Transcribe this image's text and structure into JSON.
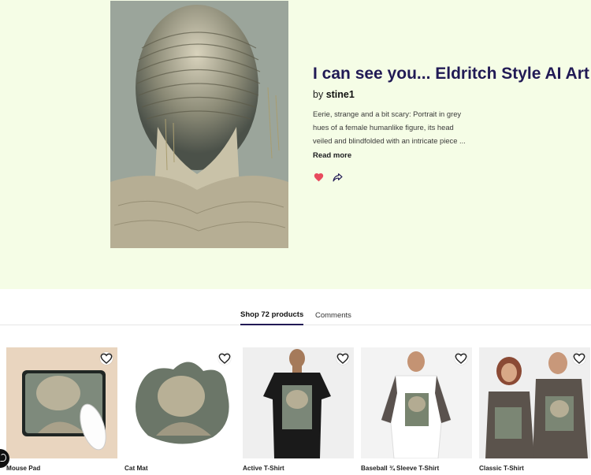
{
  "artwork": {
    "title": "I can see you... Eldritch Style AI Art",
    "by_label": "by",
    "artist": "stine1",
    "description": "Eerie, strange and a bit scary: Portrait in grey hues of a female humanlike figure, its head veiled and blindfolded with an intricate piece ...",
    "read_more": "Read more",
    "favorite_color": "#e84b5e"
  },
  "tabs": {
    "shop": "Shop 72 products",
    "comments": "Comments"
  },
  "products": [
    {
      "name": "Mouse Pad"
    },
    {
      "name": "Cat Mat"
    },
    {
      "name": "Active T-Shirt"
    },
    {
      "name": "Baseball ¾ Sleeve T-Shirt"
    },
    {
      "name": "Classic T-Shirt"
    }
  ],
  "colors": {
    "hero_bg": "#f5fde6",
    "title": "#211a55"
  },
  "icons": [
    "heart-icon",
    "share-icon",
    "heart-outline-icon",
    "chat-icon"
  ]
}
